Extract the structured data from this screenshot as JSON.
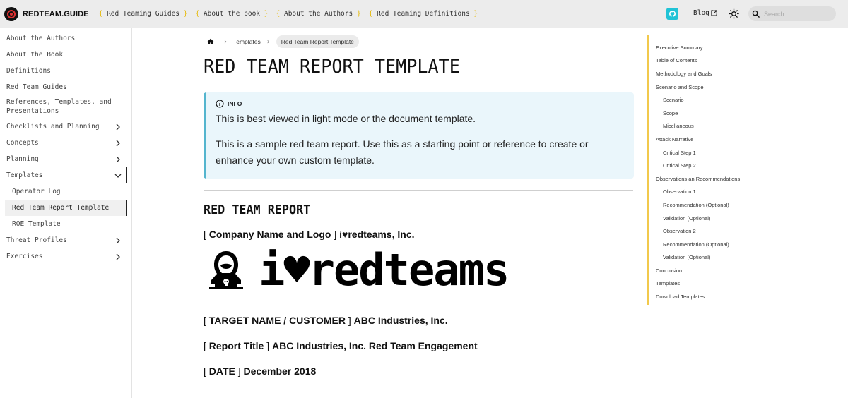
{
  "brand": {
    "name": "REDTEAM.GUIDE"
  },
  "nav": {
    "links": [
      {
        "open": "{",
        "label": "Red Teaming Guides",
        "close": "}"
      },
      {
        "open": "{",
        "label": "About the book",
        "close": "}"
      },
      {
        "open": "{",
        "label": "About the Authors",
        "close": "}"
      },
      {
        "open": "{",
        "label": "Red Teaming Definitions",
        "close": "}"
      }
    ],
    "blog_label": "Blog",
    "search_placeholder": "Search"
  },
  "sidebar": {
    "items": [
      {
        "label": "About the Authors"
      },
      {
        "label": "About the Book"
      },
      {
        "label": "Definitions"
      },
      {
        "label": "Red Team Guides"
      },
      {
        "label": "References, Templates, and Presentations"
      },
      {
        "label": "Checklists and Planning",
        "chevron": "right"
      },
      {
        "label": "Concepts",
        "chevron": "right"
      },
      {
        "label": "Planning",
        "chevron": "right"
      },
      {
        "label": "Templates",
        "chevron": "down",
        "expanded": true
      },
      {
        "label": "Operator Log",
        "sub": true
      },
      {
        "label": "Red Team Report Template",
        "sub": true,
        "active": true
      },
      {
        "label": "ROE Template",
        "sub": true
      },
      {
        "label": "Threat Profiles",
        "chevron": "right"
      },
      {
        "label": "Exercises",
        "chevron": "right"
      }
    ]
  },
  "breadcrumbs": {
    "items": [
      "Templates",
      "Red Team Report Template"
    ]
  },
  "page": {
    "title": "RED TEAM REPORT TEMPLATE",
    "info": {
      "heading": "INFO",
      "p1": "This is best viewed in light mode or the document template.",
      "p2": "This is a sample red team report. Use this as a starting point or reference to create or enhance your own custom template."
    },
    "section_title": "RED TEAM REPORT",
    "fields": [
      {
        "open": "[",
        "key": "Company Name and Logo",
        "close": "]",
        "value": "i♥redteams, Inc."
      },
      {
        "open": "[",
        "key": "TARGET NAME / CUSTOMER",
        "close": "]",
        "value": "ABC Industries, Inc."
      },
      {
        "open": "[",
        "key": "Report Title",
        "close": "]",
        "value": "ABC Industries, Inc. Red Team Engagement"
      },
      {
        "open": "[",
        "key": "DATE",
        "close": "]",
        "value": "December 2018"
      }
    ],
    "logo_text": "i♥redteams"
  },
  "toc": {
    "items": [
      {
        "label": "Executive Summary",
        "level": 1
      },
      {
        "label": "Table of Contents",
        "level": 1
      },
      {
        "label": "Methodology and Goals",
        "level": 1
      },
      {
        "label": "Scenario and Scope",
        "level": 1
      },
      {
        "label": "Scenario",
        "level": 2
      },
      {
        "label": "Scope",
        "level": 2
      },
      {
        "label": "Micellaneous",
        "level": 2
      },
      {
        "label": "Attack Narrative",
        "level": 1
      },
      {
        "label": "Critical Step 1",
        "level": 2
      },
      {
        "label": "Critical Step 2",
        "level": 2
      },
      {
        "label": "Observations an Recommendations",
        "level": 1
      },
      {
        "label": "Observation 1",
        "level": 2
      },
      {
        "label": "Recommendation (Optional)",
        "level": 2
      },
      {
        "label": "Validation (Optional)",
        "level": 2
      },
      {
        "label": "Observation 2",
        "level": 2
      },
      {
        "label": "Recommendation (Optional)",
        "level": 2
      },
      {
        "label": "Validation (Optional)",
        "level": 2
      },
      {
        "label": "Conclusion",
        "level": 1
      },
      {
        "label": "Templates",
        "level": 1
      },
      {
        "label": "Download Templates",
        "level": 1
      }
    ]
  },
  "colors": {
    "navbar_bg": "#ececec",
    "bracket_accent": "#e6b800",
    "info_border": "#54b5ce",
    "info_bg": "#eaf6fb",
    "toc_border": "#f2c94c",
    "github_button": "#20c3d6"
  }
}
